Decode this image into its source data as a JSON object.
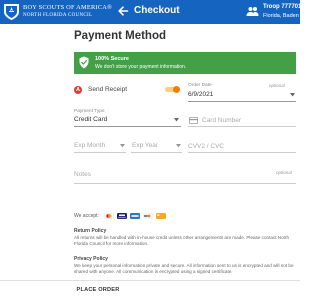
{
  "header": {
    "org_line1": "BOY SCOUTS OF AMERICA®",
    "org_line2": "NORTH FLORIDA COUNCIL",
    "title": "Checkout",
    "troop_name": "Troop 7777011",
    "troop_location": "Florida, Baden P"
  },
  "page": {
    "title": "Payment Method"
  },
  "secure_banner": {
    "title": "100% Secure",
    "text": "We don't store your payment information."
  },
  "receipt": {
    "icon_letter": "A",
    "label": "Send Receipt",
    "enabled": true
  },
  "order_date": {
    "label": "Order Date",
    "optional": "optional",
    "value": "6/9/2021"
  },
  "payment_type": {
    "label": "Payment Type",
    "value": "Credit Card"
  },
  "card_number": {
    "placeholder": "Card Number"
  },
  "exp_month": {
    "placeholder": "Exp Month"
  },
  "exp_year": {
    "placeholder": "Exp Year"
  },
  "cvv": {
    "placeholder": "CVV2 / CVC"
  },
  "notes": {
    "placeholder": "Notes",
    "optional": "optional"
  },
  "accepted_cards": {
    "label": "We accept:",
    "cards": [
      "mastercard-icon",
      "visa-icon",
      "amex-icon",
      "discover-icon",
      "credit-card-icon"
    ]
  },
  "return_policy": {
    "title": "Return Policy",
    "text": "All returns will be handled with in-house credit unless other arrangements are made. Please contact North Florida Council for more information."
  },
  "privacy_policy": {
    "title": "Privacy Policy",
    "text": "We keep your personal information private and secure. All information sent to us is encrypted and will not be shared with anyone. All communication is encrypted using a signed certificate."
  },
  "footer": {
    "place_order_label": "PLACE ORDER"
  },
  "colors": {
    "header_bg": "#1565c0",
    "secure_green": "#43a047",
    "toggle_orange": "#f57c00",
    "receipt_red": "#e53935"
  }
}
